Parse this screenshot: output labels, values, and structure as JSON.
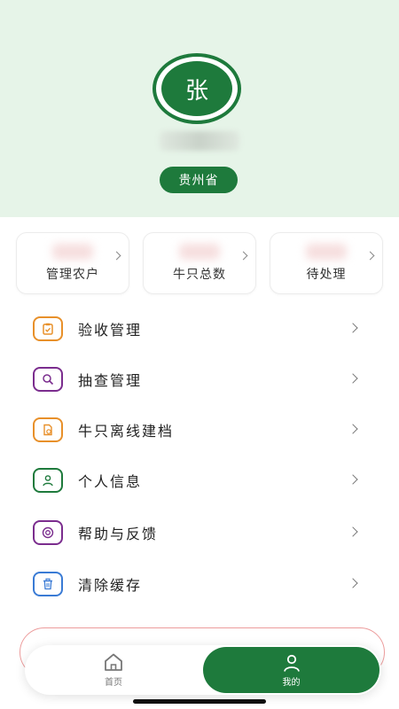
{
  "profile": {
    "avatar_char": "张",
    "province": "贵州省"
  },
  "stats": [
    {
      "label": "管理农户"
    },
    {
      "label": "牛只总数"
    },
    {
      "label": "待处理"
    }
  ],
  "menu": [
    {
      "label": "验收管理",
      "icon": "clipboard-check-icon",
      "color": "#e8902a"
    },
    {
      "label": "抽查管理",
      "icon": "search-icon",
      "color": "#7b2d8e"
    },
    {
      "label": "牛只离线建档",
      "icon": "offline-file-icon",
      "color": "#e8902a"
    },
    {
      "label": "个人信息",
      "icon": "user-icon",
      "color": "#1e7a3c"
    },
    {
      "label": "帮助与反馈",
      "icon": "lifebuoy-icon",
      "color": "#7b2d8e"
    },
    {
      "label": "清除缓存",
      "icon": "trash-icon",
      "color": "#3a7bd5"
    }
  ],
  "tabbar": {
    "home_label": "首页",
    "mine_label": "我的"
  },
  "colors": {
    "brand_green": "#1e7a3c",
    "header_bg": "#e6f4e8",
    "logout_red": "#e05a5a"
  }
}
